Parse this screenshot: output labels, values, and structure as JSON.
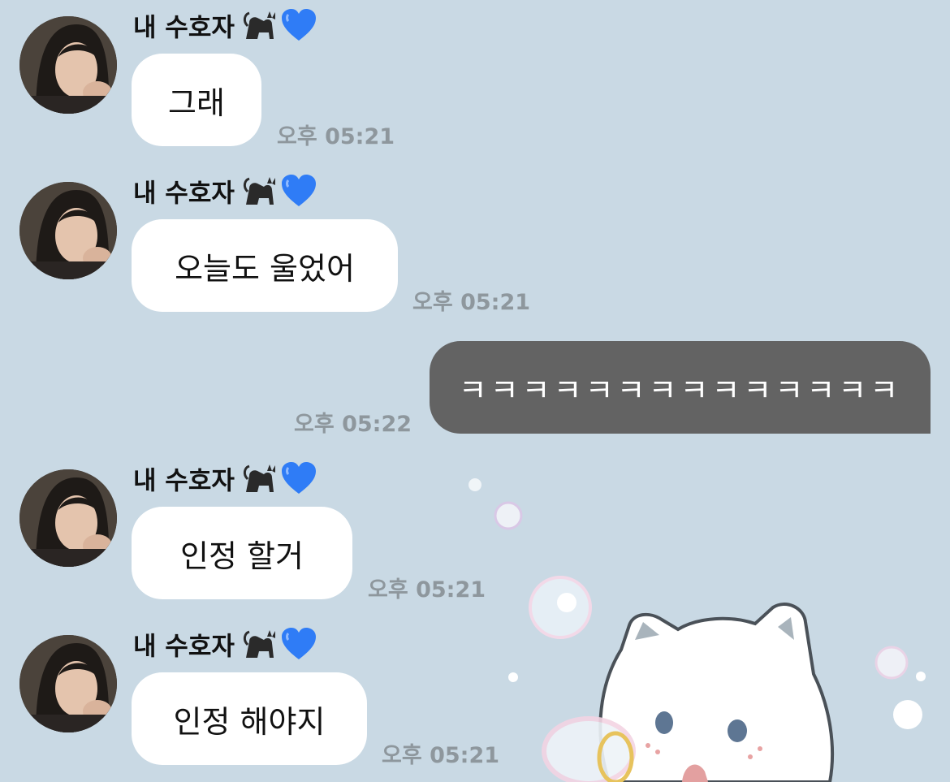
{
  "conversation": {
    "messages": [
      {
        "sender": "내 수호자",
        "text": "그래",
        "time": "오후 05:21"
      },
      {
        "sender": "내 수호자",
        "text": "오늘도 울었어",
        "time": "오후 05:21"
      },
      {
        "text": "ㅋㅋㅋㅋㅋㅋㅋㅋㅋㅋㅋㅋㅋㅋ",
        "time": "오후 05:22"
      },
      {
        "sender": "내 수호자",
        "text": "인정 할거",
        "time": "오후 05:21"
      },
      {
        "sender": "내 수호자",
        "text": "인정 해야지",
        "time": "오후 05:21"
      }
    ]
  },
  "icons": {
    "sender_emoji_1": "black-cat-emoji",
    "sender_emoji_2": "blue-heart-emoji",
    "wallpaper": "white-cat-bubbles-illustration"
  },
  "colors": {
    "background": "#c9d9e4",
    "incoming_bubble": "#ffffff",
    "outgoing_bubble": "#636363",
    "timestamp": "#8e979d"
  }
}
